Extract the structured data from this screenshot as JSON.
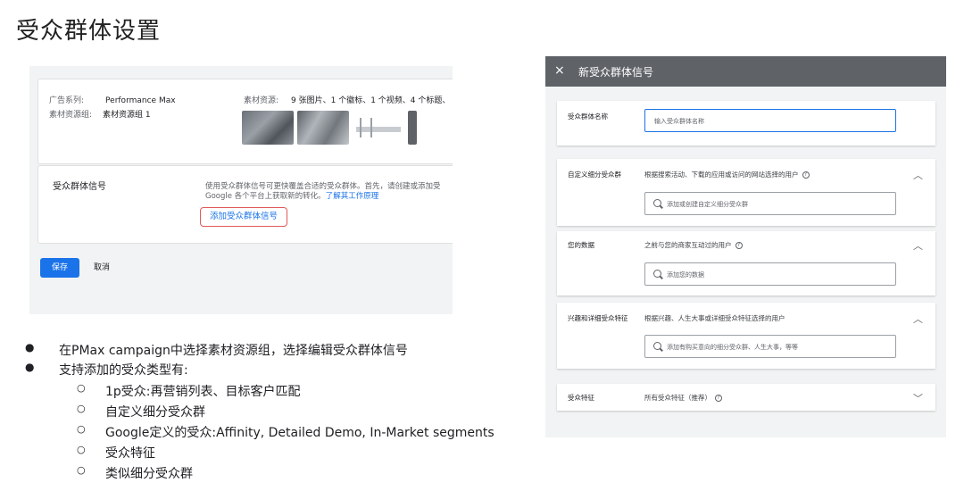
{
  "slide": {
    "title": "受众群体设置"
  },
  "left_panel": {
    "campaign_label": "广告系列:",
    "campaign_value": "Performance Max",
    "asset_group_label": "素材资源组:",
    "asset_group_value": "素材资源组 1",
    "assets_label": "素材资源:",
    "assets_value": "9 张图片、1 个徽标、1 个视频、4 个标题、",
    "signal_title": "受众群体信号",
    "signal_desc_line1": "使用受众群体信号可更快覆盖合适的受众群体。首先，请创建或添加受",
    "signal_desc_line2": "Google 各个平台上获取新的转化。",
    "signal_link": "了解其工作原理",
    "add_signal_button": "添加受众群体信号",
    "save_button": "保存",
    "cancel_button": "取消"
  },
  "bullets": {
    "items": [
      "在PMax campaign中选择素材资源组，选择编辑受众群体信号",
      "支持添加的受众类型有:"
    ],
    "sub_items": [
      "1p受众:再营销列表、目标客户匹配",
      "自定义细分受众群",
      "Google定义的受众:Affinity, Detailed Demo, In-Market segments",
      "受众特征",
      "类似细分受众群"
    ],
    "bullet_char": "●",
    "sub_bullet_char": "○"
  },
  "dialog": {
    "close_icon": "×",
    "title": "新受众群体信号",
    "name_label": "受众群体名称",
    "name_placeholder": "输入受众群体名称",
    "custom_label": "自定义细分受众群",
    "custom_desc": "根据搜索活动、下载的应用或访问的网站选择的用户",
    "custom_placeholder": "添加或创建自定义细分受众群",
    "your_data_label": "您的数据",
    "your_data_desc": "之前与您的商家互动过的用户",
    "your_data_placeholder": "添加您的数据",
    "interests_label": "兴趣和详细受众特征",
    "interests_desc": "根据兴趣、人生大事或详细受众特征选择的用户",
    "interests_placeholder": "添加有购买意向的细分受众群、人生大事，等等",
    "demographics_label": "受众特征",
    "demographics_desc": "所有受众特征（推荐）",
    "chevron_up": "︿",
    "chevron_down": "﹀",
    "help_glyph": "?"
  },
  "colors": {
    "accent": "#1a73e8",
    "dialog_header": "#5f6368",
    "highlight_border": "#e05a5a"
  }
}
